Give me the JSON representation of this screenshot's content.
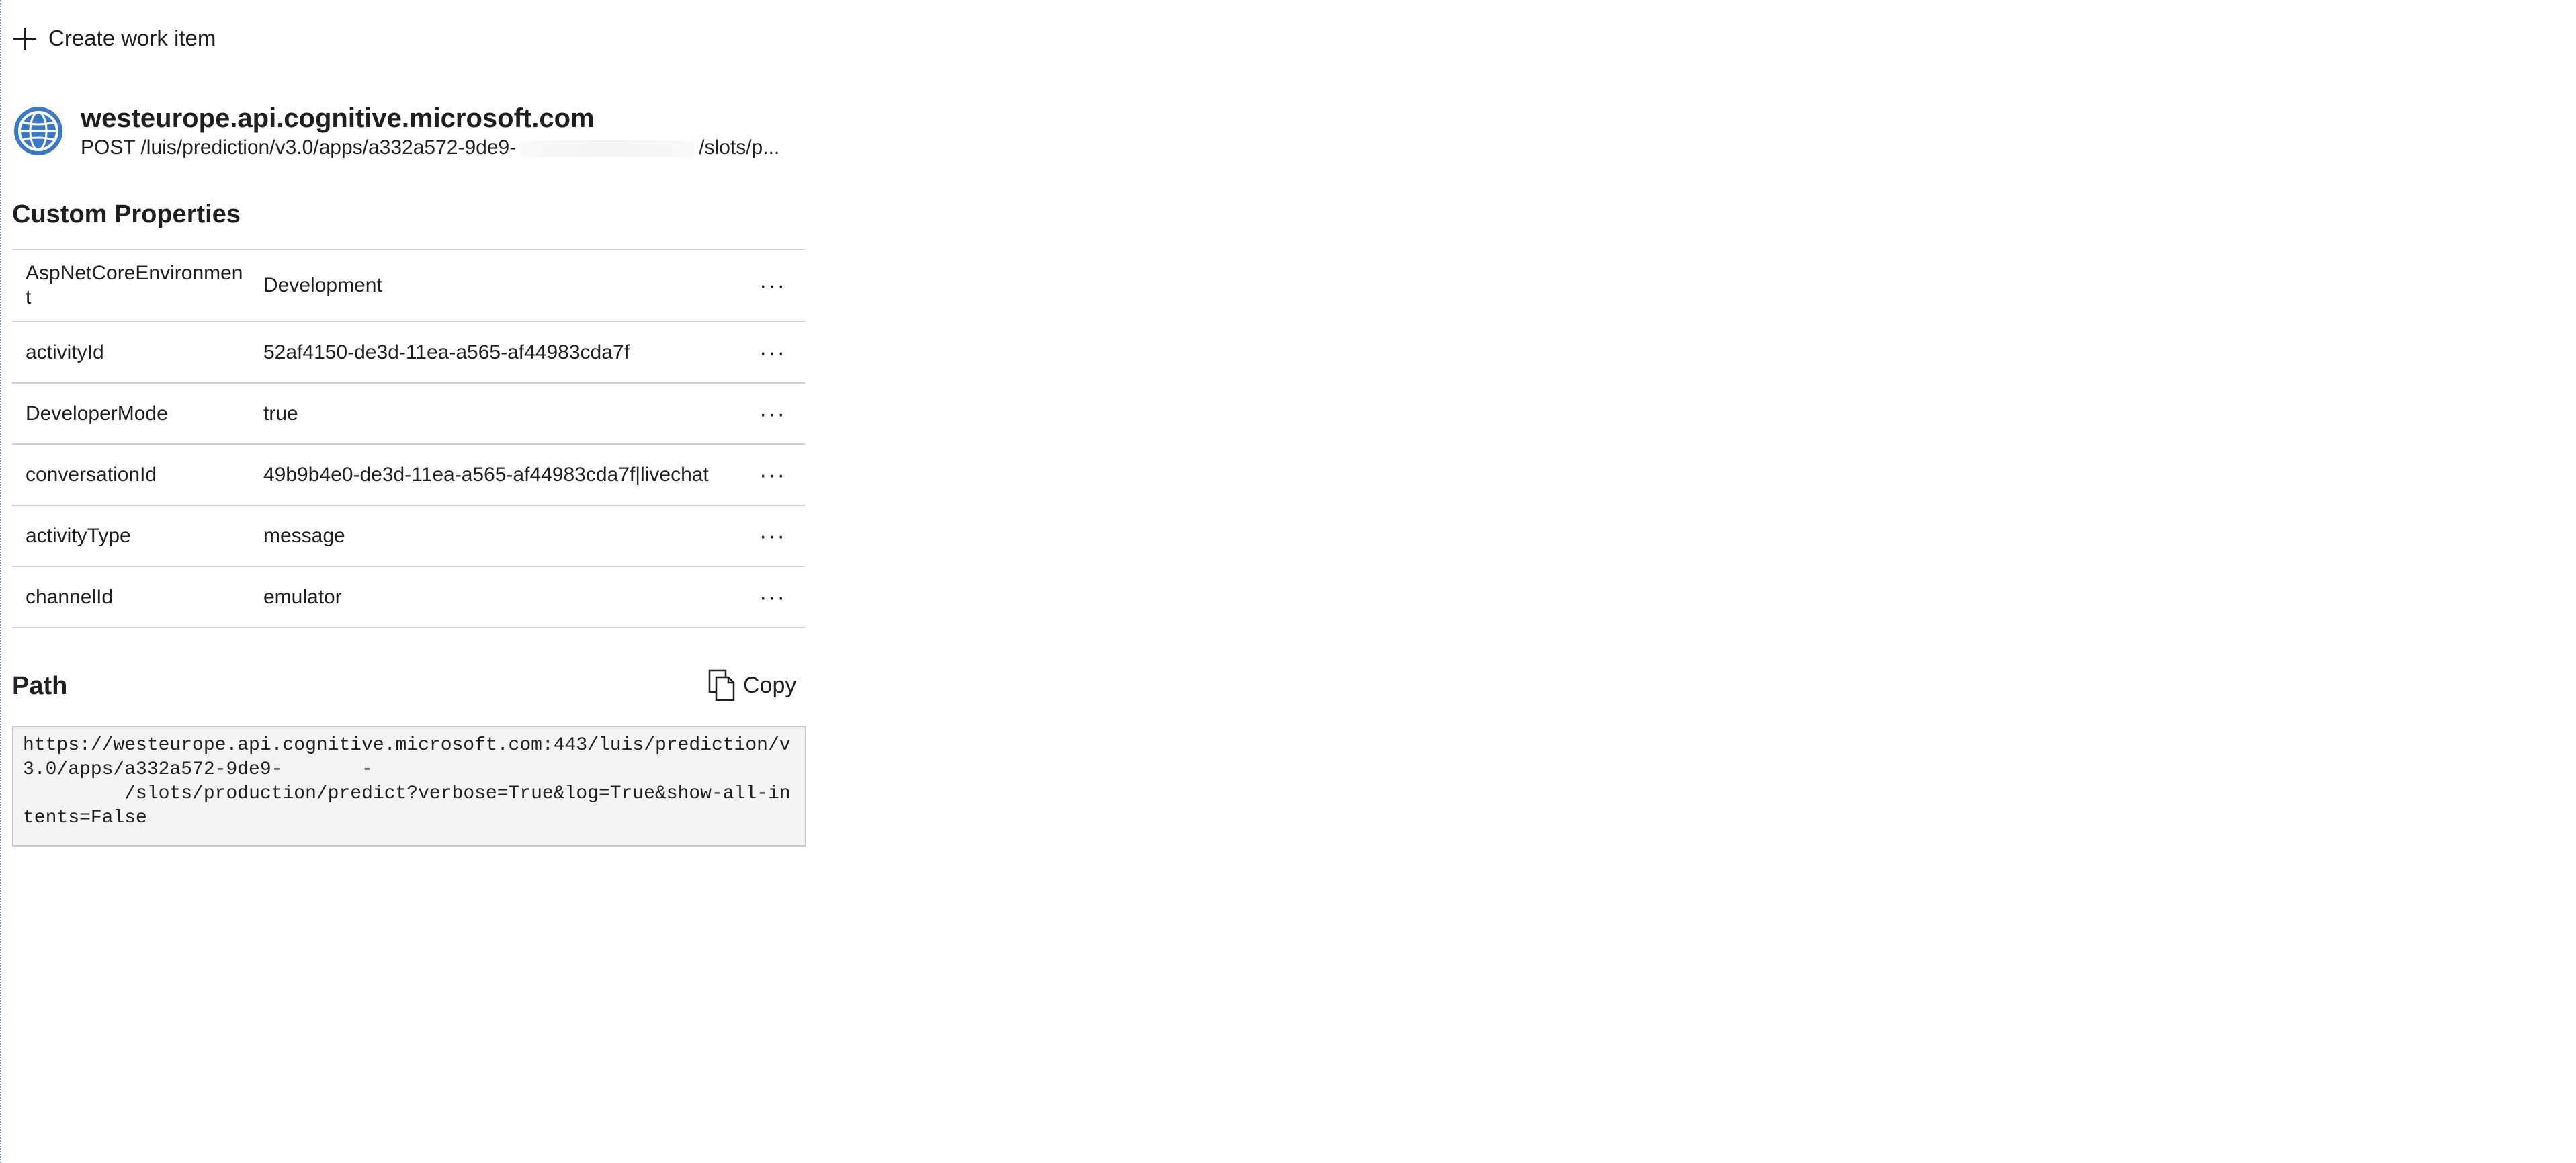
{
  "toolbar": {
    "create_label": "Create work item",
    "create_icon": "plus-icon"
  },
  "request": {
    "host": "westeurope.api.cognitive.microsoft.com",
    "method_path_start": "POST /luis/prediction/v3.0/apps/a332a572-9de9-",
    "method_path_end": "/slots/p...",
    "icon": "globe-icon",
    "icon_color": "#3a78c9"
  },
  "custom_properties": {
    "title": "Custom Properties",
    "rows": [
      {
        "key": "AspNetCoreEnvironment",
        "value": "Development"
      },
      {
        "key": "activityId",
        "value": "52af4150-de3d-11ea-a565-af44983cda7f"
      },
      {
        "key": "DeveloperMode",
        "value": "true"
      },
      {
        "key": "conversationId",
        "value": "49b9b4e0-de3d-11ea-a565-af44983cda7f|livechat"
      },
      {
        "key": "activityType",
        "value": "message"
      },
      {
        "key": "channelId",
        "value": "emulator"
      }
    ],
    "more_label": "···"
  },
  "path": {
    "title": "Path",
    "copy_label": "Copy",
    "copy_icon": "copy-icon",
    "value": "https://westeurope.api.cognitive.microsoft.com:443/luis/prediction/v3.0/apps/a332a572-9de9-       -\n         /slots/production/predict?verbose=True&log=True&show-all-intents=False"
  }
}
